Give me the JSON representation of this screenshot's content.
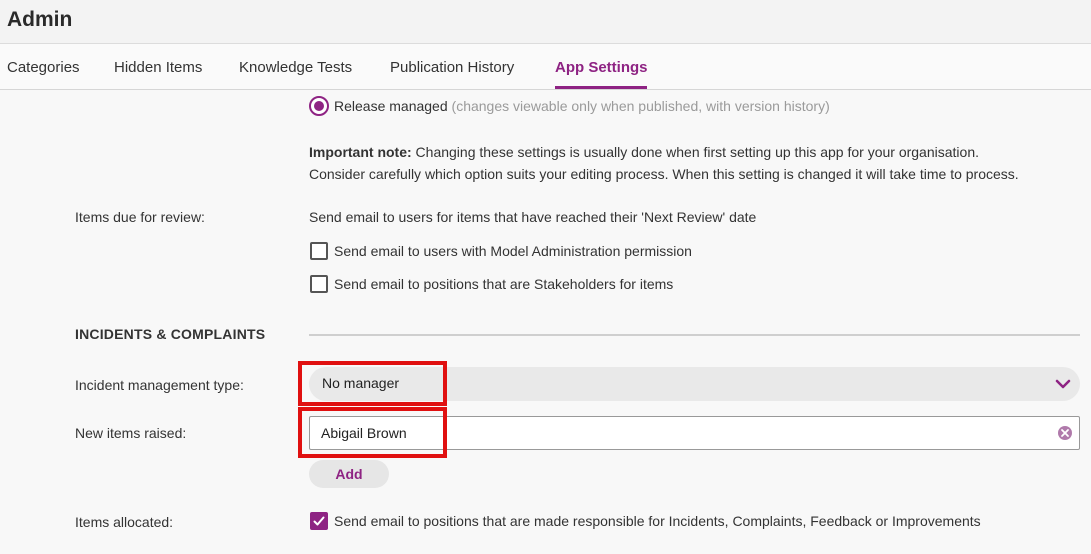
{
  "header": {
    "title": "Admin"
  },
  "tabs": [
    {
      "label": "Categories",
      "active": false
    },
    {
      "label": "Hidden Items",
      "active": false
    },
    {
      "label": "Knowledge Tests",
      "active": false
    },
    {
      "label": "Publication History",
      "active": false
    },
    {
      "label": "App Settings",
      "active": true
    }
  ],
  "publishing": {
    "release_label": "Release managed",
    "release_hint": "(changes viewable only when published, with version history)",
    "note_bold": "Important note:",
    "note_line1": "Changing these settings is usually done when first setting up this app for your organisation.",
    "note_line2": "Consider carefully which option suits your editing process. When this setting is changed it will take time to process."
  },
  "review": {
    "label": "Items due for review:",
    "description": "Send email to users for items that have reached their 'Next Review' date",
    "options": [
      {
        "label": "Send email to users with Model Administration permission",
        "checked": false
      },
      {
        "label": "Send email to positions that are Stakeholders for items",
        "checked": false
      }
    ]
  },
  "incidents": {
    "section_title": "INCIDENTS & COMPLAINTS",
    "management_type_label": "Incident management type:",
    "management_type_value": "No manager",
    "new_items_label": "New items raised:",
    "new_items_value": "Abigail Brown",
    "add_label": "Add",
    "allocated_label": "Items allocated:",
    "allocated_option": "Send email to positions that are made responsible for Incidents, Complaints, Feedback or Improvements",
    "allocated_checked": true
  },
  "colors": {
    "accent": "#8e2383",
    "highlight": "#e01010"
  }
}
